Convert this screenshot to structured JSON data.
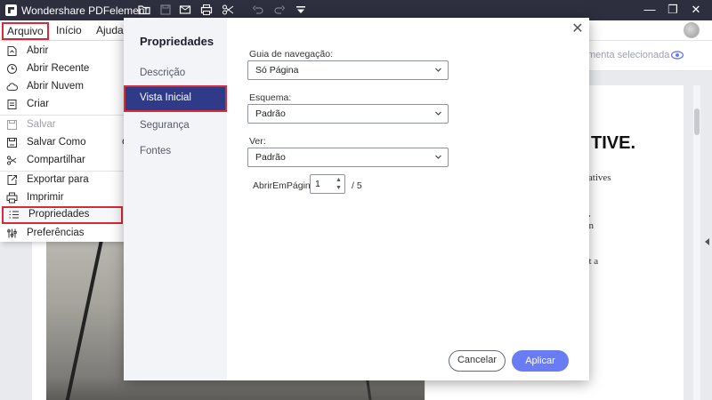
{
  "app": {
    "title": "Wondershare PDFelement",
    "toolbar_icons": [
      "folder-icon",
      "save-icon",
      "mail-icon",
      "print-icon",
      "scissors-icon",
      "undo-icon",
      "redo-icon",
      "dropdown-icon"
    ],
    "window_controls": {
      "minimize": "—",
      "restore": "❐",
      "close": "✕"
    }
  },
  "menubar": {
    "items": [
      "Arquivo",
      "Início",
      "Ajuda"
    ]
  },
  "ribbon": {
    "selection_text": "menta selecionada"
  },
  "file_menu": {
    "items": [
      {
        "label": "Abrir",
        "icon": "open-icon",
        "enabled": true
      },
      {
        "label": "Abrir Recente",
        "icon": "clock-icon",
        "enabled": true
      },
      {
        "label": "Abrir Nuvem",
        "icon": "cloud-icon",
        "enabled": true
      },
      {
        "label": "Criar",
        "icon": "create-icon",
        "enabled": true
      },
      {
        "label": "Salvar",
        "icon": "save-icon",
        "enabled": false
      },
      {
        "label": "Salvar Como",
        "icon": "save-as-icon",
        "enabled": true
      },
      {
        "label": "Compartilhar",
        "icon": "share-icon",
        "enabled": true
      },
      {
        "label": "Exportar para",
        "icon": "export-icon",
        "enabled": true
      },
      {
        "label": "Imprimir",
        "icon": "print-icon",
        "enabled": true
      },
      {
        "label": "Propriedades",
        "icon": "properties-icon",
        "enabled": true,
        "highlighted": true
      },
      {
        "label": "Preferências",
        "icon": "preferences-icon",
        "enabled": true
      }
    ],
    "peek_char": "C"
  },
  "document": {
    "heading": "TIVE.",
    "lines": [
      "eatives",
      "e,",
      "vn",
      "ut a"
    ]
  },
  "dialog": {
    "title": "Propriedades",
    "nav": [
      "Descrição",
      "Vista Inicial",
      "Segurança",
      "Fontes"
    ],
    "active_nav": "Vista Inicial",
    "fields": {
      "navigation": {
        "label": "Guia de navegação:",
        "value": "Só Página"
      },
      "layout": {
        "label": "Esquema:",
        "value": "Padrão"
      },
      "view": {
        "label": "Ver:",
        "value": "Padrão"
      },
      "open_page": {
        "label": "AbrirEmPágina:",
        "value": "1",
        "total": "/ 5"
      }
    },
    "buttons": {
      "cancel": "Cancelar",
      "apply": "Aplicar"
    },
    "close_glyph": "✕"
  },
  "colors": {
    "titlebar": "#2d2f3f",
    "highlight_border": "#d62b39",
    "active_nav": "#2f3a88",
    "apply_button": "#6a7cf3"
  }
}
